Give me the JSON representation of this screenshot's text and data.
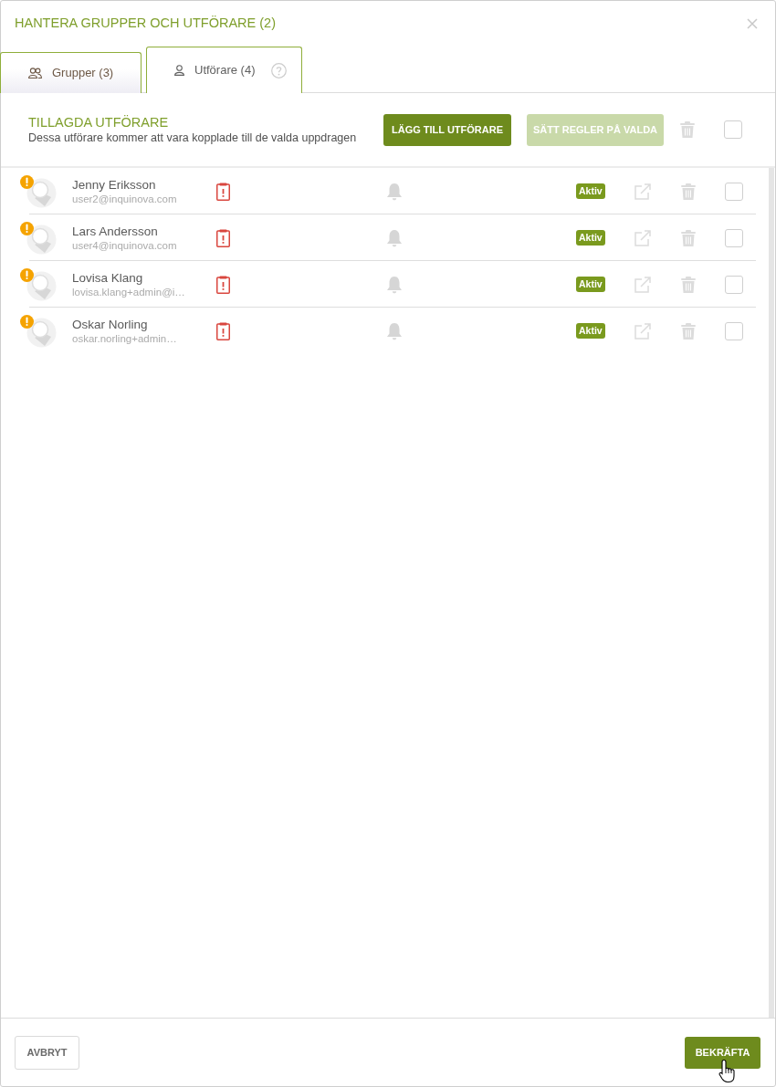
{
  "dialog": {
    "title": "HANTERA GRUPPER OCH UTFÖRARE (2)"
  },
  "tabs": [
    {
      "label": "Grupper (3)",
      "kind": "groups",
      "selected": false,
      "help": false
    },
    {
      "label": "Utförare (4)",
      "kind": "users",
      "selected": true,
      "help": true
    }
  ],
  "section": {
    "title": "TILLAGDA UTFÖRARE",
    "subtitle": "Dessa utförare kommer att vara kopplade till de valda uppdragen",
    "buttons": [
      {
        "label": "LÄGG TILL UTFÖRARE",
        "disabled": false
      },
      {
        "label": "SÄTT REGLER PÅ VALDA",
        "disabled": true
      }
    ],
    "select_all_checked": false
  },
  "rows": [
    {
      "name": "Jenny Eriksson",
      "email": "user2@inquinova.com",
      "warning": true,
      "status": "Aktiv",
      "checked": false
    },
    {
      "name": "Lars Andersson",
      "email": "user4@inquinova.com",
      "warning": true,
      "status": "Aktiv",
      "checked": false
    },
    {
      "name": "Lovisa Klang",
      "email": "lovisa.klang+admin@i…",
      "warning": true,
      "status": "Aktiv",
      "checked": false
    },
    {
      "name": "Oskar Norling",
      "email": "oskar.norling+admin…",
      "warning": true,
      "status": "Aktiv",
      "checked": false
    }
  ],
  "footer": {
    "cancel": "AVBRYT",
    "confirm": "BEKRÄFTA"
  }
}
